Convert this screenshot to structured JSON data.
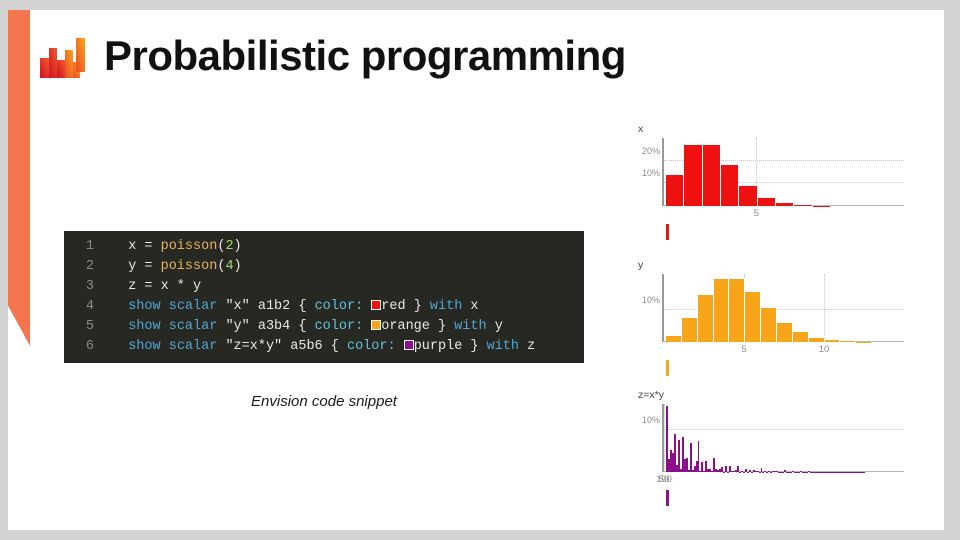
{
  "slide": {
    "title": "Probabilistic programming",
    "logo_name": "envision-bar-logo",
    "accent_color": "#f4764f",
    "background": "#ffffff",
    "canvas_background": "#d4d4d4"
  },
  "code_snippet": {
    "caption": "Envision code snippet",
    "background": "#272822",
    "lines": [
      {
        "number": "1",
        "tokens": [
          {
            "t": "  x = ",
            "c": "plain"
          },
          {
            "t": "poisson",
            "c": "fn"
          },
          {
            "t": "(",
            "c": "punc"
          },
          {
            "t": "2",
            "c": "num"
          },
          {
            "t": ")",
            "c": "punc"
          }
        ]
      },
      {
        "number": "2",
        "tokens": [
          {
            "t": "  y = ",
            "c": "plain"
          },
          {
            "t": "poisson",
            "c": "fn"
          },
          {
            "t": "(",
            "c": "punc"
          },
          {
            "t": "4",
            "c": "num"
          },
          {
            "t": ")",
            "c": "punc"
          }
        ]
      },
      {
        "number": "3",
        "tokens": [
          {
            "t": "  z = x * y",
            "c": "plain"
          }
        ]
      },
      {
        "number": "4",
        "tokens": [
          {
            "t": "  ",
            "c": "plain"
          },
          {
            "t": "show",
            "c": "kw"
          },
          {
            "t": " ",
            "c": "plain"
          },
          {
            "t": "scalar",
            "c": "kw"
          },
          {
            "t": " ",
            "c": "plain"
          },
          {
            "t": "\"x\"",
            "c": "str"
          },
          {
            "t": " a1b2 { ",
            "c": "plain"
          },
          {
            "t": "color:",
            "c": "prop"
          },
          {
            "t": " ",
            "c": "plain"
          },
          {
            "t": "SWATCH:#ee1111",
            "c": "swatch"
          },
          {
            "t": "red",
            "c": "plain"
          },
          {
            "t": " } ",
            "c": "plain"
          },
          {
            "t": "with",
            "c": "kw"
          },
          {
            "t": " x",
            "c": "plain"
          }
        ]
      },
      {
        "number": "5",
        "tokens": [
          {
            "t": "  ",
            "c": "plain"
          },
          {
            "t": "show",
            "c": "kw"
          },
          {
            "t": " ",
            "c": "plain"
          },
          {
            "t": "scalar",
            "c": "kw"
          },
          {
            "t": " ",
            "c": "plain"
          },
          {
            "t": "\"y\"",
            "c": "str"
          },
          {
            "t": " a3b4 { ",
            "c": "plain"
          },
          {
            "t": "color:",
            "c": "prop"
          },
          {
            "t": " ",
            "c": "plain"
          },
          {
            "t": "SWATCH:#f9a51a",
            "c": "swatch"
          },
          {
            "t": "orange",
            "c": "plain"
          },
          {
            "t": " } ",
            "c": "plain"
          },
          {
            "t": "with",
            "c": "kw"
          },
          {
            "t": " y",
            "c": "plain"
          }
        ]
      },
      {
        "number": "6",
        "tokens": [
          {
            "t": "  ",
            "c": "plain"
          },
          {
            "t": "show",
            "c": "kw"
          },
          {
            "t": " ",
            "c": "plain"
          },
          {
            "t": "scalar",
            "c": "kw"
          },
          {
            "t": " ",
            "c": "plain"
          },
          {
            "t": "\"z=x*y\"",
            "c": "str"
          },
          {
            "t": " a5b6 { ",
            "c": "plain"
          },
          {
            "t": "color:",
            "c": "prop"
          },
          {
            "t": " ",
            "c": "plain"
          },
          {
            "t": "SWATCH:#8e0f8e",
            "c": "swatch"
          },
          {
            "t": "purple",
            "c": "plain"
          },
          {
            "t": " } ",
            "c": "plain"
          },
          {
            "t": "with",
            "c": "kw"
          },
          {
            "t": " z",
            "c": "plain"
          }
        ]
      }
    ]
  },
  "chart_data": [
    {
      "type": "bar",
      "id": "chart-x",
      "title": "x",
      "color": "#ee1111",
      "xlabel": "",
      "ylabel": "",
      "ylim": [
        0,
        30
      ],
      "grid": true,
      "yticks": [
        10,
        20
      ],
      "ytick_labels": [
        "10%",
        "20%"
      ],
      "xticks": [
        5
      ],
      "xtick_labels": [
        "5"
      ],
      "categories": [
        0,
        1,
        2,
        3,
        4,
        5,
        6,
        7,
        8,
        9,
        10,
        11,
        12
      ],
      "values": [
        13.5,
        27.1,
        27.1,
        18.0,
        9.0,
        3.6,
        1.2,
        0.4,
        0.1,
        0,
        0,
        0,
        0
      ]
    },
    {
      "type": "bar",
      "id": "chart-y",
      "title": "y",
      "color": "#f9a51a",
      "xlabel": "",
      "ylabel": "",
      "ylim": [
        0,
        21
      ],
      "grid": true,
      "yticks": [
        10
      ],
      "ytick_labels": [
        "10%"
      ],
      "xticks": [
        5,
        10
      ],
      "xtick_labels": [
        "5",
        "10"
      ],
      "categories": [
        0,
        1,
        2,
        3,
        4,
        5,
        6,
        7,
        8,
        9,
        10,
        11,
        12,
        13,
        14
      ],
      "values": [
        1.8,
        7.3,
        14.6,
        19.5,
        19.5,
        15.6,
        10.4,
        6.0,
        3.0,
        1.3,
        0.5,
        0.2,
        0.1,
        0,
        0
      ]
    },
    {
      "type": "bar",
      "id": "chart-z",
      "title": "z=x*y",
      "color": "#8e0f8e",
      "xlabel": "",
      "ylabel": "",
      "ylim": [
        0,
        16
      ],
      "grid": true,
      "yticks": [
        10
      ],
      "ytick_labels": [
        "10%"
      ],
      "xticks": [
        50,
        100
      ],
      "xtick_labels": [
        "50",
        "100"
      ],
      "categories": [
        0,
        1,
        2,
        3,
        4,
        5,
        6,
        7,
        8,
        9,
        10,
        11,
        12,
        13,
        14,
        15,
        16,
        17,
        18,
        19,
        20,
        21,
        22,
        23,
        24,
        25,
        26,
        27,
        28,
        29,
        30,
        31,
        32,
        33,
        34,
        35,
        36,
        37,
        38,
        39,
        40,
        41,
        42,
        43,
        44,
        45,
        46,
        47,
        48,
        49,
        50,
        51,
        52,
        53,
        54,
        55,
        56,
        57,
        58,
        59,
        60,
        61,
        62,
        63,
        64,
        65,
        66,
        67,
        68,
        69,
        70,
        71,
        72,
        73,
        74,
        75,
        76,
        77,
        78,
        79,
        80,
        81,
        82,
        83,
        84,
        85,
        86,
        87,
        88,
        89,
        90,
        91,
        92,
        93,
        94,
        95,
        96,
        97,
        98,
        99,
        100,
        101,
        102,
        103,
        104,
        105,
        106,
        107,
        108,
        109,
        110,
        111,
        112,
        113,
        114,
        115,
        116,
        117,
        118,
        119
      ],
      "values": [
        15.5,
        3.0,
        5.2,
        4.4,
        9.0,
        1.6,
        7.6,
        0.8,
        8.2,
        3.0,
        3.2,
        0.5,
        6.8,
        0.4,
        1.4,
        2.6,
        7.2,
        0.3,
        2.3,
        0.2,
        2.6,
        0.8,
        0.6,
        0.2,
        3.4,
        0.6,
        0.5,
        0.6,
        1.1,
        0.1,
        1.4,
        0.1,
        1.5,
        0.2,
        0.3,
        0.5,
        1.3,
        0.1,
        0.2,
        0.1,
        0.8,
        0.1,
        0.5,
        0.1,
        0.4,
        0.3,
        0.2,
        0.1,
        0.9,
        0.1,
        0.2,
        0.1,
        0.3,
        0.1,
        0.2,
        0.2,
        0.3,
        0.1,
        0.1,
        0.1,
        0.4,
        0.05,
        0.1,
        0.05,
        0.2,
        0.1,
        0.1,
        0.05,
        0.2,
        0.05,
        0.1,
        0.05,
        0.3,
        0.05,
        0.05,
        0.05,
        0.1,
        0.05,
        0.05,
        0.05,
        0.1,
        0.02,
        0.05,
        0.02,
        0.05,
        0.05,
        0.05,
        0.02,
        0.1,
        0.02,
        0.02,
        0.02,
        0.05,
        0.02,
        0.02,
        0.02,
        0.05,
        0.02,
        0.02,
        0.02,
        0.05,
        0,
        0,
        0,
        0,
        0,
        0,
        0,
        0,
        0,
        0,
        0,
        0,
        0,
        0,
        0,
        0,
        0,
        0,
        0,
        0
      ]
    }
  ]
}
